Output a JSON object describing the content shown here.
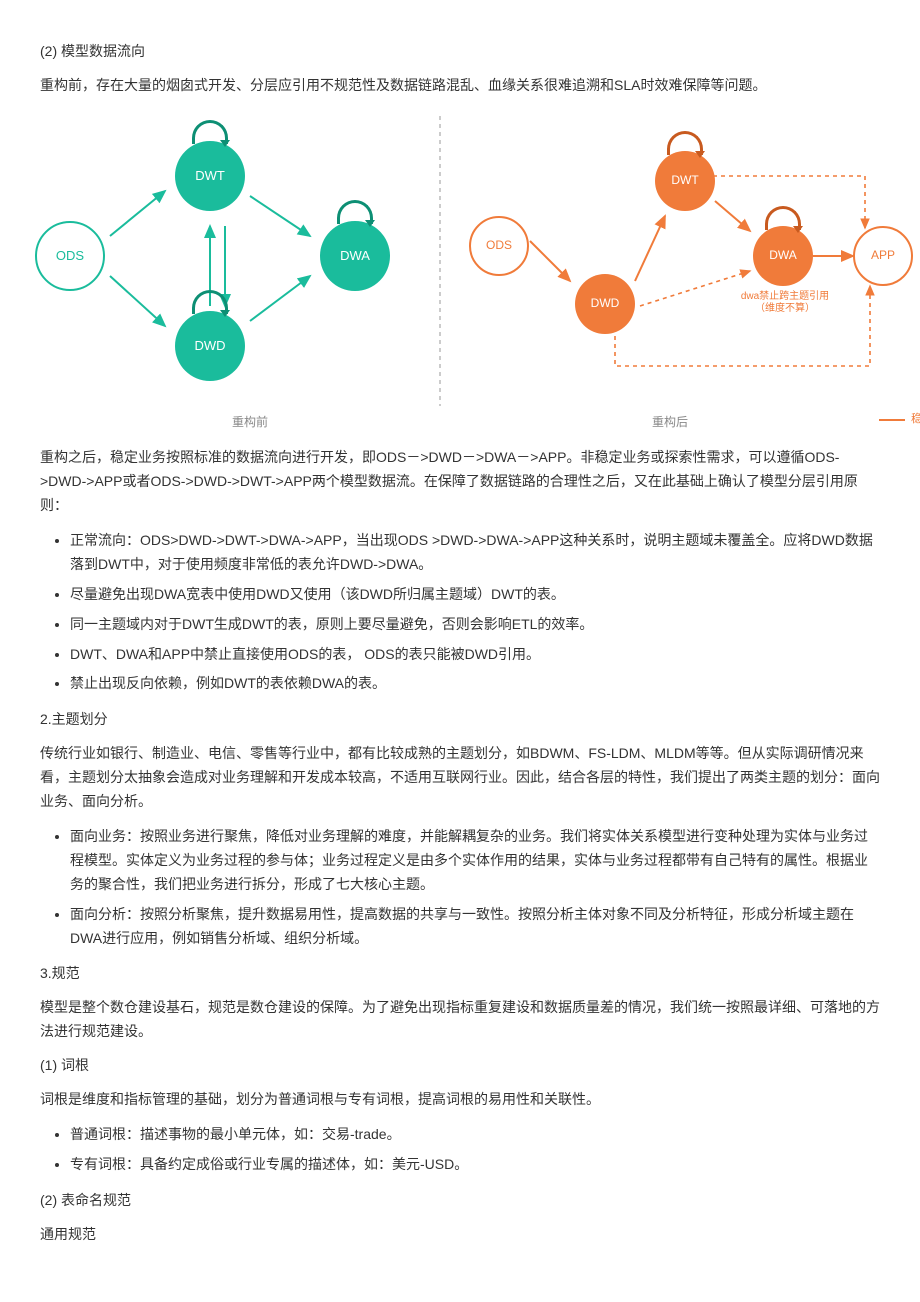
{
  "h_model_flow": "(2) 模型数据流向",
  "p_before": "重构前，存在大量的烟囱式开发、分层应引用不规范性及数据链路混乱、血缘关系很难追溯和SLA时效难保障等问题。",
  "diagram": {
    "labels": {
      "ODS": "ODS",
      "DWT": "DWT",
      "DWD": "DWD",
      "DWA": "DWA",
      "APP": "APP"
    },
    "caption_before": "重构前",
    "caption_after": "重构后",
    "note_dwa": "dwa禁止跨主题引用（维度不算）",
    "legend_stable": "稳定业务"
  },
  "p_after": "重构之后，稳定业务按照标准的数据流向进行开发，即ODS－>DWD－>DWA－>APP。非稳定业务或探索性需求，可以遵循ODS->DWD->APP或者ODS->DWD->DWT->APP两个模型数据流。在保障了数据链路的合理性之后，又在此基础上确认了模型分层引用原则：",
  "rules": [
    "正常流向：ODS>DWD->DWT->DWA->APP，当出现ODS >DWD->DWA->APP这种关系时，说明主题域未覆盖全。应将DWD数据落到DWT中，对于使用频度非常低的表允许DWD->DWA。",
    "尽量避免出现DWA宽表中使用DWD又使用（该DWD所归属主题域）DWT的表。",
    "同一主题域内对于DWT生成DWT的表，原则上要尽量避免，否则会影响ETL的效率。",
    "DWT、DWA和APP中禁止直接使用ODS的表， ODS的表只能被DWD引用。",
    "禁止出现反向依赖，例如DWT的表依赖DWA的表。"
  ],
  "h_topic": "2.主题划分",
  "p_topic": "传统行业如银行、制造业、电信、零售等行业中，都有比较成熟的主题划分，如BDWM、FS-LDM、MLDM等等。但从实际调研情况来看，主题划分太抽象会造成对业务理解和开发成本较高，不适用互联网行业。因此，结合各层的特性，我们提出了两类主题的划分：面向业务、面向分析。",
  "topics": [
    "面向业务：按照业务进行聚焦，降低对业务理解的难度，并能解耦复杂的业务。我们将实体关系模型进行变种处理为实体与业务过程模型。实体定义为业务过程的参与体；业务过程定义是由多个实体作用的结果，实体与业务过程都带有自己特有的属性。根据业务的聚合性，我们把业务进行拆分，形成了七大核心主题。",
    "面向分析：按照分析聚焦，提升数据易用性，提高数据的共享与一致性。按照分析主体对象不同及分析特征，形成分析域主题在DWA进行应用，例如销售分析域、组织分析域。"
  ],
  "h_spec": "3.规范",
  "p_spec": "模型是整个数仓建设基石，规范是数仓建设的保障。为了避免出现指标重复建设和数据质量差的情况，我们统一按照最详细、可落地的方法进行规范建设。",
  "h_root": "(1) 词根",
  "p_root": "词根是维度和指标管理的基础，划分为普通词根与专有词根，提高词根的易用性和关联性。",
  "roots": [
    "普通词根：描述事物的最小单元体，如：交易-trade。",
    "专有词根：具备约定成俗或行业专属的描述体，如：美元-USD。"
  ],
  "h_naming": "(2) 表命名规范",
  "p_naming_sub": "通用规范"
}
